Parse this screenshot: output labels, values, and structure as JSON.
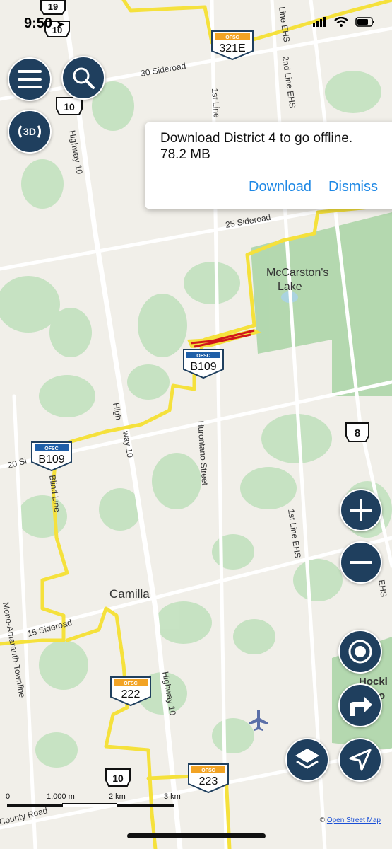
{
  "status": {
    "time": "9:50"
  },
  "popup": {
    "message": "Download District 4 to go offline.",
    "size": "78.2 MB",
    "download_label": "Download",
    "dismiss_label": "Dismiss"
  },
  "map": {
    "places": {
      "lake": "McCarston's",
      "lake2": "Lake",
      "camilla": "Camilla",
      "hockley_1": "Hockl",
      "hockley_2": "Pro"
    },
    "roads": {
      "highway10_a": "Highway 10",
      "highway10_b": "High",
      "highway10_c": "way 10",
      "highway10_d": "Highway 10",
      "sideroad30": "30 Sideroad",
      "sideroad25": "25 Sideroad",
      "sideroad20": "20 Si",
      "sideroad15": "15 Sideroad",
      "line1ehs_top": "1st Line",
      "line1ehs": "1st Line EHS",
      "line2ehs": "2nd Line EHS",
      "line_ehs_top": "Line EHS",
      "hurontario": "Hurontario Street",
      "blind_line": "Blind Line",
      "mono_amaranth": "Mono-Amaranth-Townline",
      "county_road": "County Road",
      "ehs_right": "EHS"
    },
    "shields": {
      "hwy19": "19",
      "hwy10_top": "10",
      "hwy10_mid": "10",
      "hwy10_bottom": "10",
      "hwy8": "8"
    },
    "trails": {
      "brand": "OFSC",
      "t321e": "321E",
      "tb109_top": "B109",
      "tb109_left": "B109",
      "t222": "222",
      "t223": "223"
    }
  },
  "controls": {
    "menu_icon": "hamburger-menu-icon",
    "search_icon": "magnifier-icon",
    "mode_3d": "3D",
    "zoom_in_icon": "plus-icon",
    "zoom_out_icon": "minus-icon",
    "record_icon": "record-icon",
    "route_icon": "turn-right-arrow-icon",
    "layers_icon": "layers-icon",
    "locate_icon": "navigation-arrow-icon"
  },
  "scale": {
    "zero": "0",
    "m1000": "1,000 m",
    "km2": "2 km",
    "km3": "3 km"
  },
  "attribution": {
    "prefix": "© ",
    "link": "Open Street Map"
  },
  "colors": {
    "trail": "#f5e13c",
    "trail_closed": "#d0161b",
    "button": "#1f3f5e",
    "link": "#1e88e5",
    "woods": "#bfe0bc"
  }
}
